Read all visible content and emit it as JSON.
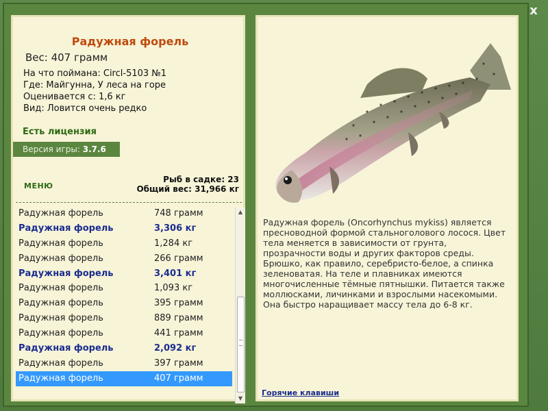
{
  "window": {
    "close_label": "x"
  },
  "fish": {
    "title": "Радужная форель",
    "weight": "Вес: 407 грамм",
    "caught_with": "На что поймана: Circl-5103 №1",
    "location": "Где: Майгунна, У леса на горе",
    "valued_from": "Оценивается с: 1,6 кг",
    "rarity": "Вид: Ловится очень редко",
    "license": "Есть лицензия",
    "version_label": "Версия игры:",
    "version_value": "3.7.6"
  },
  "menu_label": "МЕНЮ",
  "cage": {
    "count": "Рыб в садке: 23",
    "total_weight": "Общий вес: 31,966 кг"
  },
  "catch_list": [
    {
      "name": "Радужная форель",
      "weight": "748 грамм",
      "record": false,
      "selected": false
    },
    {
      "name": "Радужная форель",
      "weight": "3,306 кг",
      "record": true,
      "selected": false
    },
    {
      "name": "Радужная форель",
      "weight": "1,284 кг",
      "record": false,
      "selected": false
    },
    {
      "name": "Радужная форель",
      "weight": "266 грамм",
      "record": false,
      "selected": false
    },
    {
      "name": "Радужная форель",
      "weight": "3,401 кг",
      "record": true,
      "selected": false
    },
    {
      "name": "Радужная форель",
      "weight": "1,093 кг",
      "record": false,
      "selected": false
    },
    {
      "name": "Радужная форель",
      "weight": "395 грамм",
      "record": false,
      "selected": false
    },
    {
      "name": "Радужная форель",
      "weight": "889 грамм",
      "record": false,
      "selected": false
    },
    {
      "name": "Радужная форель",
      "weight": "441 грамм",
      "record": false,
      "selected": false
    },
    {
      "name": "Радужная форель",
      "weight": "2,092 кг",
      "record": true,
      "selected": false
    },
    {
      "name": "Радужная форель",
      "weight": "397 грамм",
      "record": false,
      "selected": false
    },
    {
      "name": "Радужная форель",
      "weight": "407 грамм",
      "record": false,
      "selected": true
    }
  ],
  "description": "Радужная форель (Oncorhynchus mykiss) является пресноводной формой стальноголового лосося. Цвет тела меняется в зависимости от грунта, прозрачности воды и других факторов среды. Брюшко, как правило, серебристо-белое, а спинка зеленоватая. На теле и плавниках имеются многочисленные тёмные пятнышки. Питается также моллюсками, личинками и взрослыми насекомыми. Она быстро наращивает массу тела до 6-8 кг.",
  "hotkeys_label": "Горячие клавиши",
  "colors": {
    "frame": "#5b8640",
    "panel": "#f7f4d8",
    "title": "#c04a0e",
    "record": "#1b2d8f",
    "selected": "#3399ff"
  }
}
